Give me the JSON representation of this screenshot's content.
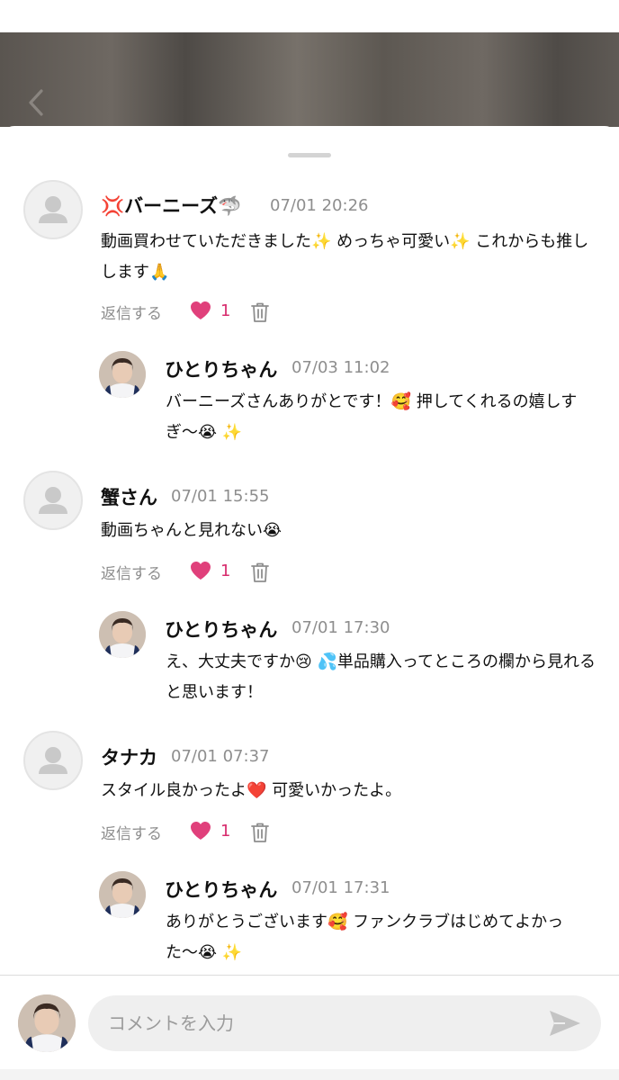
{
  "composer": {
    "placeholder": "コメントを入力"
  },
  "colors": {
    "like_heart": "#e0407b",
    "like_count": "#d72c6d",
    "meta_gray": "#8e8e8e"
  },
  "icons": {
    "back": "chevron-left-icon",
    "heart": "heart-icon",
    "trash": "trash-icon",
    "send": "send-icon",
    "default_avatar": "user-icon"
  },
  "comments": [
    {
      "name": "💢バーニーズ🦈",
      "time": "07/01 20:26",
      "text": "動画買わせていただきました✨ めっちゃ可愛い✨ これからも推しします🙏",
      "reply_label": "返信する",
      "likes": "1",
      "reply": {
        "name": "ひとりちゃん",
        "time": "07/03 11:02",
        "text": "バーニーズさんありがとです！🥰 押してくれるの嬉しすぎ〜😭 ✨"
      }
    },
    {
      "name": "蟹さん",
      "time": "07/01 15:55",
      "text": "動画ちゃんと見れない😭",
      "reply_label": "返信する",
      "likes": "1",
      "reply": {
        "name": "ひとりちゃん",
        "time": "07/01 17:30",
        "text": "え、大丈夫ですか😢 💦単品購入ってところの欄から見れると思います！"
      }
    },
    {
      "name": "タナカ",
      "time": "07/01 07:37",
      "text": "スタイル良かったよ❤️ 可愛いかったよ。",
      "reply_label": "返信する",
      "likes": "1",
      "reply": {
        "name": "ひとりちゃん",
        "time": "07/01 17:31",
        "text": "ありがとうございます🥰 ファンクラブはじめてよかった〜😭 ✨"
      }
    }
  ]
}
